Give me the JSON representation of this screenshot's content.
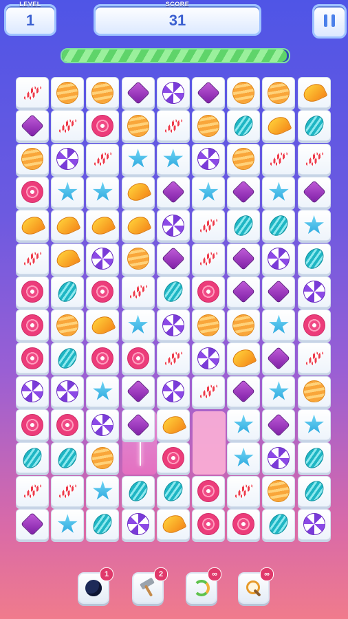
{
  "hud": {
    "level_label": "LEVEL",
    "level_value": "1",
    "score_label": "SCORE",
    "score_value": "31"
  },
  "timer": {
    "progress": 0.99
  },
  "board": {
    "rows": [
      [
        "cane",
        "orange",
        "orange",
        "diamond",
        "purple-swirl",
        "diamond",
        "orange",
        "orange",
        "lemon"
      ],
      [
        "diamond",
        "cane",
        "pink",
        "orange",
        "cane",
        "orange",
        "teal",
        "lemon",
        "teal"
      ],
      [
        "orange",
        "purple-swirl",
        "cane",
        "star",
        "star",
        "purple-swirl",
        "orange",
        "cane",
        "cane"
      ],
      [
        "pink",
        "star",
        "star",
        "lemon",
        "diamond",
        "star",
        "diamond",
        "star",
        "diamond"
      ],
      [
        "lemon",
        "lemon",
        "lemon",
        "lemon",
        "purple-swirl",
        "cane",
        "teal",
        "teal",
        "star"
      ],
      [
        "cane",
        "lemon",
        "purple-swirl",
        "orange",
        "diamond",
        "cane",
        "diamond",
        "purple-swirl",
        "teal"
      ],
      [
        "pink",
        "teal",
        "pink",
        "cane",
        "teal",
        "pink",
        "diamond",
        "diamond",
        "purple-swirl"
      ],
      [
        "pink",
        "orange",
        "lemon",
        "star",
        "purple-swirl",
        "orange",
        "orange",
        "star",
        "pink"
      ],
      [
        "pink",
        "teal",
        "pink",
        "pink",
        "cane",
        "purple-swirl",
        "lemon",
        "diamond",
        "cane"
      ],
      [
        "purple-swirl",
        "purple-swirl",
        "star",
        "diamond",
        "purple-swirl",
        "cane",
        "diamond",
        "star",
        "orange"
      ],
      [
        "pink",
        "pink",
        "purple-swirl",
        "diamond",
        "lemon",
        "",
        "star",
        "diamond",
        "star"
      ],
      [
        "teal",
        "teal",
        "orange",
        "",
        "pink",
        "",
        "star",
        "purple-swirl",
        "teal"
      ],
      [
        "cane",
        "cane",
        "star",
        "teal",
        "teal",
        "pink",
        "cane",
        "orange",
        "teal"
      ],
      [
        "diamond",
        "star",
        "teal",
        "purple-swirl",
        "lemon",
        "pink",
        "pink",
        "teal",
        "purple-swirl"
      ]
    ]
  },
  "boosters": [
    {
      "name": "bomb",
      "icon": "bomb-icon",
      "count": "1"
    },
    {
      "name": "hammer",
      "icon": "hammer-icon",
      "count": "2"
    },
    {
      "name": "shuffle",
      "icon": "shuffle-icon",
      "count": "∞"
    },
    {
      "name": "hint",
      "icon": "magnifier-icon",
      "count": "∞"
    }
  ]
}
